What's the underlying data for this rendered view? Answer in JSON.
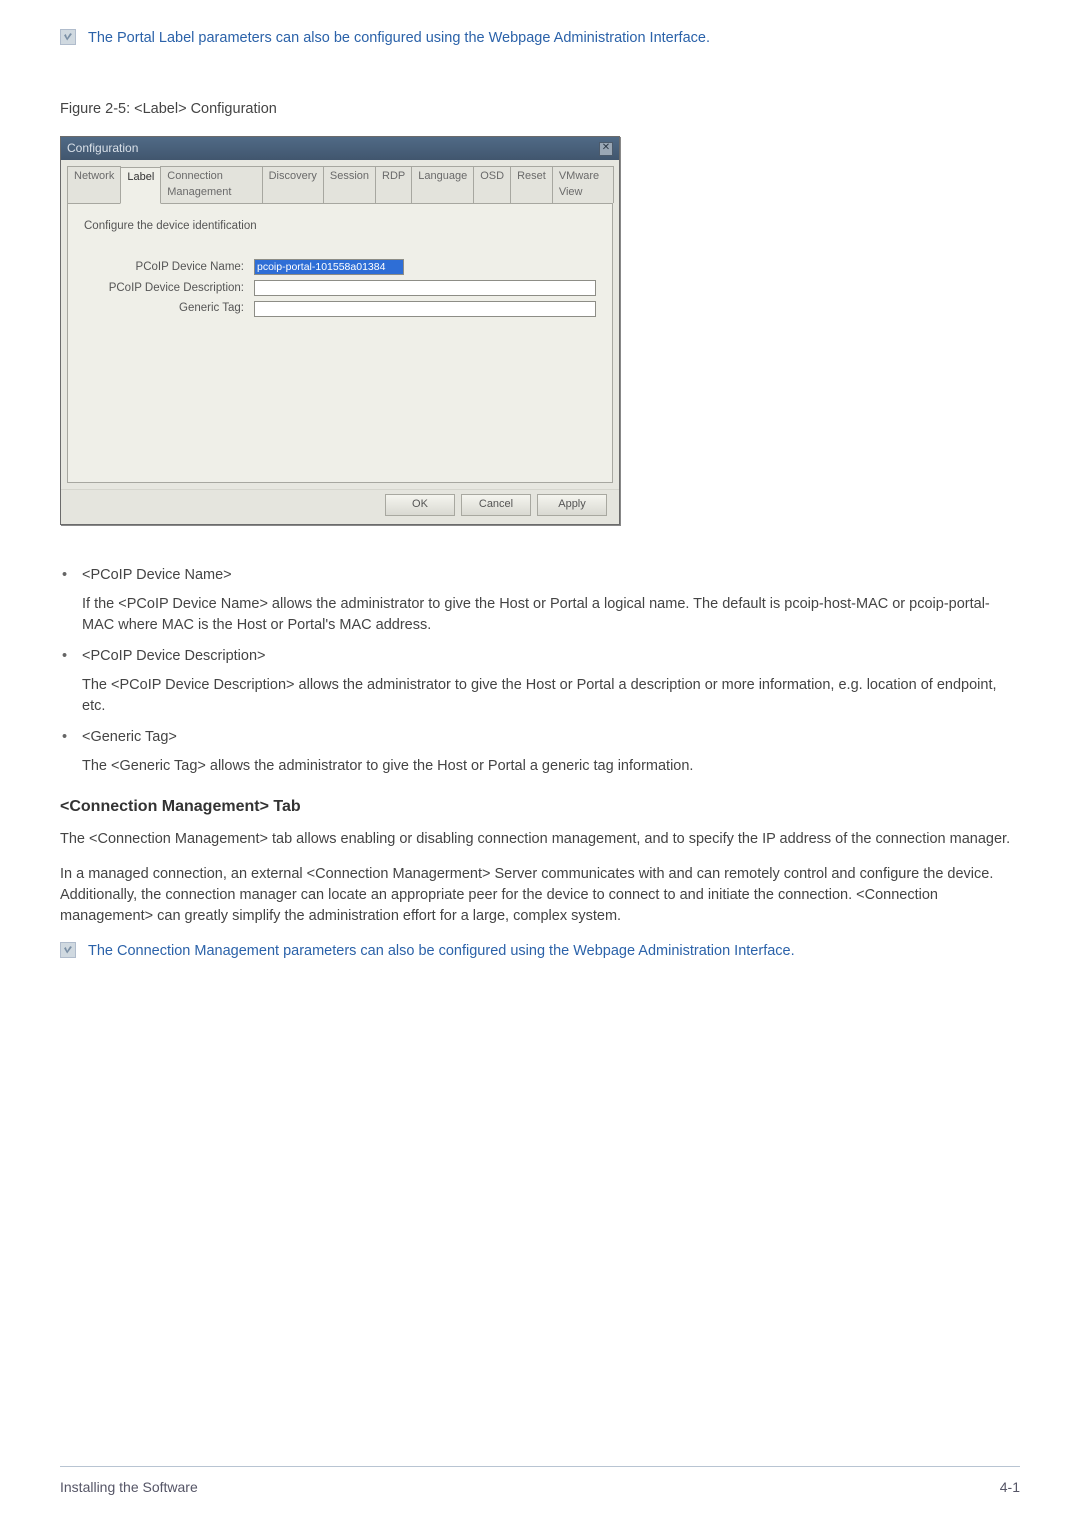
{
  "notes": {
    "top": "The Portal Label parameters can also be configured using the Webpage Administration Interface.",
    "bottom": "The Connection Management parameters can also be configured using the Webpage Administration Interface."
  },
  "figure_caption": "Figure 2-5: <Label> Configuration",
  "dialog": {
    "title": "Configuration",
    "tabs": [
      "Network",
      "Label",
      "Connection Management",
      "Discovery",
      "Session",
      "RDP",
      "Language",
      "OSD",
      "Reset",
      "VMware View"
    ],
    "active_tab": "Label",
    "body_header": "Configure the device identification",
    "fields": {
      "device_name_label": "PCoIP Device Name:",
      "device_name_value": "pcoip-portal-101558a01384",
      "device_desc_label": "PCoIP Device Description:",
      "device_desc_value": "",
      "generic_tag_label": "Generic Tag:",
      "generic_tag_value": ""
    },
    "buttons": {
      "ok": "OK",
      "cancel": "Cancel",
      "apply": "Apply"
    }
  },
  "bullets": [
    {
      "title": "<PCoIP Device Name>",
      "desc": "If the <PCoIP Device Name> allows the administrator to give the Host or Portal a logical name.  The default is pcoip-host-MAC or pcoip-portal-MAC where MAC is the Host or Portal's MAC address."
    },
    {
      "title": "<PCoIP Device Description>",
      "desc": "The <PCoIP Device Description> allows the administrator to give the Host or Portal a description or more information, e.g. location of endpoint, etc."
    },
    {
      "title": "<Generic Tag>",
      "desc": "The <Generic Tag> allows the administrator to give the Host or Portal a generic tag information."
    }
  ],
  "section_heading": "<Connection Management> Tab",
  "paragraphs": {
    "p1": "The <Connection Management> tab allows enabling or disabling connection management, and to specify the IP address of the connection manager.",
    "p2": "In a managed connection, an external <Connection Managerment> Server communicates with and can remotely control and configure the device. Additionally, the connection manager can locate an appropriate peer for the device to connect to and initiate the connection. <Connection management> can greatly simplify the administration effort for a large, complex system."
  },
  "footer": {
    "left": "Installing the Software",
    "right": "4-1"
  }
}
